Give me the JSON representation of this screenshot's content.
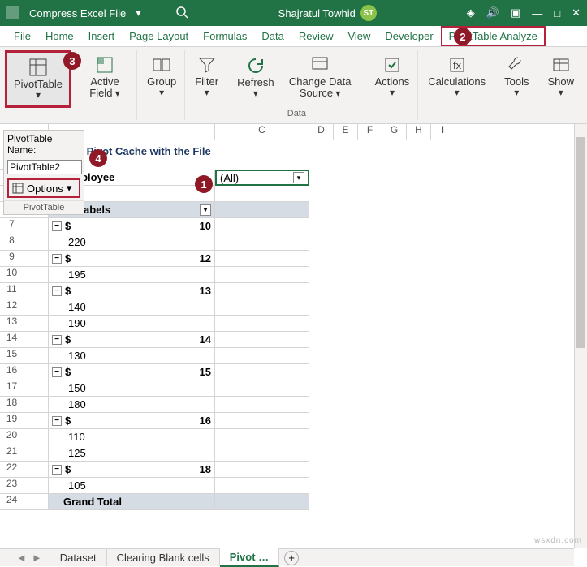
{
  "title": {
    "filename": "Compress Excel File",
    "user": "Shajratul Towhid",
    "avatar": "ST"
  },
  "tabs": [
    "File",
    "Home",
    "Insert",
    "Page Layout",
    "Formulas",
    "Data",
    "Review",
    "View",
    "Developer",
    "PivotTable Analyze"
  ],
  "ribbon": {
    "pivottable": "PivotTable",
    "activefield": "Active Field",
    "group": "Group",
    "filter": "Filter",
    "refresh": "Refresh",
    "changedata": "Change Data Source",
    "actions": "Actions",
    "calculations": "Calculations",
    "tools": "Tools",
    "show": "Show",
    "datagroup": "Data"
  },
  "pvt": {
    "name_label": "PivotTable Name:",
    "name_value": "PivotTable2",
    "options": "Options",
    "footer": "PivotTable"
  },
  "callouts": {
    "c1": "1",
    "c2": "2",
    "c3": "3",
    "c4": "4"
  },
  "colheads": [
    "C",
    "D",
    "E",
    "F",
    "G",
    "H",
    "I"
  ],
  "sheet": {
    "title": "ng the Pivot Cache with the File",
    "pt_field_label": "of Employee",
    "pt_field_value": "(All)",
    "rowlabels": "Row Labels",
    "grandtotal": "Grand Total"
  },
  "pivot_rows": [
    {
      "rh": "7",
      "type": "head",
      "sym": "$",
      "val": "10"
    },
    {
      "rh": "8",
      "type": "item",
      "val": "220"
    },
    {
      "rh": "9",
      "type": "head",
      "sym": "$",
      "val": "12"
    },
    {
      "rh": "10",
      "type": "item",
      "val": "195"
    },
    {
      "rh": "11",
      "type": "head",
      "sym": "$",
      "val": "13"
    },
    {
      "rh": "12",
      "type": "item",
      "val": "140"
    },
    {
      "rh": "13",
      "type": "item",
      "val": "190"
    },
    {
      "rh": "14",
      "type": "head",
      "sym": "$",
      "val": "14"
    },
    {
      "rh": "15",
      "type": "item",
      "val": "130"
    },
    {
      "rh": "16",
      "type": "head",
      "sym": "$",
      "val": "15"
    },
    {
      "rh": "17",
      "type": "item",
      "val": "150"
    },
    {
      "rh": "18",
      "type": "item",
      "val": "180"
    },
    {
      "rh": "19",
      "type": "head",
      "sym": "$",
      "val": "16"
    },
    {
      "rh": "20",
      "type": "item",
      "val": "110"
    },
    {
      "rh": "21",
      "type": "item",
      "val": "125"
    },
    {
      "rh": "22",
      "type": "head",
      "sym": "$",
      "val": "18"
    },
    {
      "rh": "23",
      "type": "item",
      "val": "105"
    }
  ],
  "sheets": [
    "Dataset",
    "Clearing Blank cells",
    "Pivot …"
  ],
  "watermark": "wsxdn.com"
}
